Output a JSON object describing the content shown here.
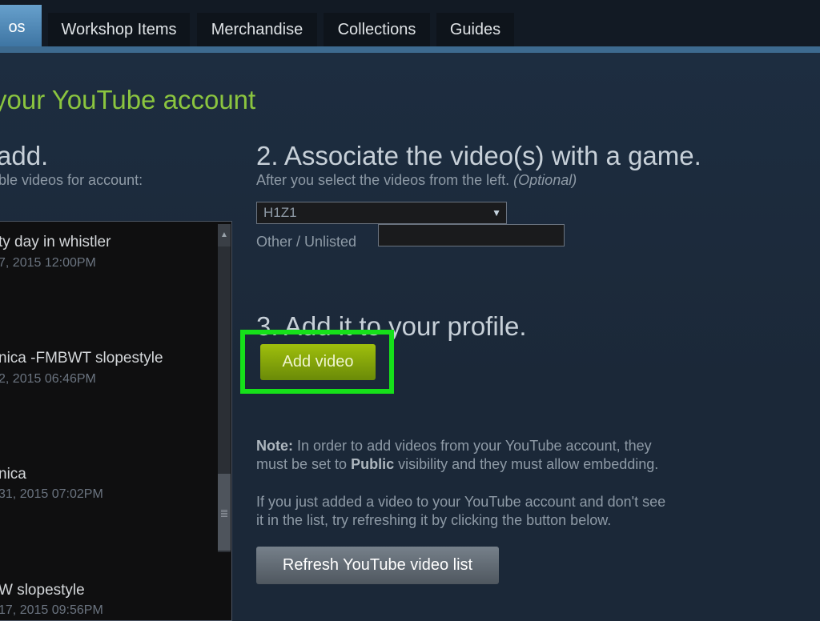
{
  "tabs": [
    {
      "label": "os",
      "active": true
    },
    {
      "label": "Workshop Items",
      "active": false
    },
    {
      "label": "Merchandise",
      "active": false
    },
    {
      "label": "Collections",
      "active": false
    },
    {
      "label": "Guides",
      "active": false
    }
  ],
  "page_title": "your YouTube account",
  "step1": {
    "heading": "add.",
    "subtext": "ble videos for account:"
  },
  "videos": [
    {
      "title": "ty day in whistler",
      "date": "7, 2015 12:00PM"
    },
    {
      "title": "nica -FMBWT slopestyle",
      "date": "2, 2015 06:46PM"
    },
    {
      "title": "nica",
      "date": "31, 2015 07:02PM"
    },
    {
      "title": "W slopestyle",
      "date": "17, 2015 09:56PM"
    }
  ],
  "step2": {
    "heading": "2. Associate the video(s) with a game.",
    "subtext": "After you select the videos from the left.",
    "subtext_optional": "(Optional)",
    "game_selected": "H1Z1",
    "other_label": "Other / Unlisted",
    "other_value": ""
  },
  "step3": {
    "heading": "3. Add it to your profile.",
    "button_label": "Add video"
  },
  "note": {
    "label": "Note:",
    "line1_rest": "In order to add videos from your YouTube account, they",
    "line2_pre": "must be set to",
    "line2_bold": "Public",
    "line2_post": "visibility and they must allow embedding.",
    "refresh_line1": "If you just added a video to your YouTube account and don't see",
    "refresh_line2": "it in the list, try refreshing it by clicking the button below."
  },
  "refresh_button_label": "Refresh YouTube video list",
  "colors": {
    "accent_green": "#8bc53f",
    "highlight": "#16e01a",
    "tab_active": "#4f8ab8",
    "background": "#1b2838"
  }
}
